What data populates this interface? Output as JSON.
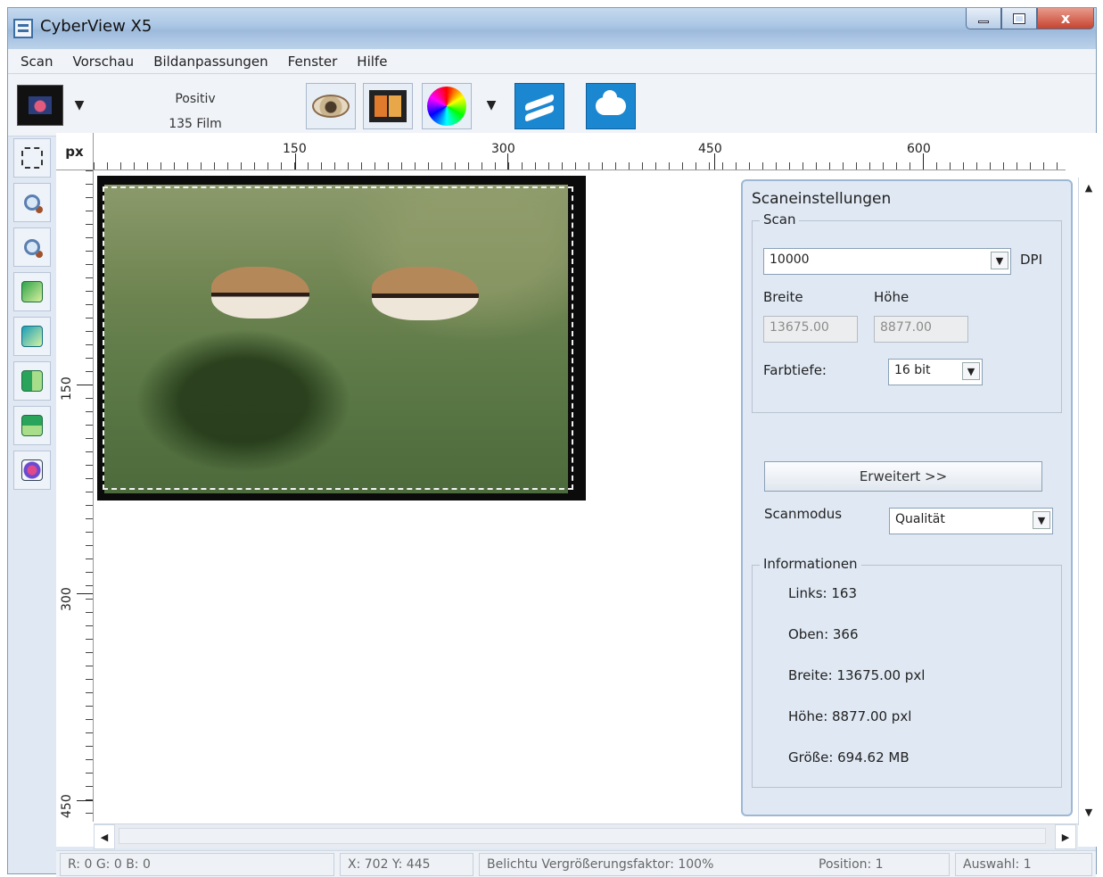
{
  "window": {
    "title": "CyberView X5",
    "controls": {
      "minimize": "",
      "maximize": "",
      "close": "x"
    }
  },
  "menu": [
    "Scan",
    "Vorschau",
    "Bildanpassungen",
    "Fenster",
    "Hilfe"
  ],
  "toolbar": {
    "mode_line1": "Positiv",
    "mode_line2": "135 Film",
    "dropdown_arrow": "▼",
    "icons": [
      "film-thumbnail-icon",
      "eye-icon",
      "filmstrip-icon",
      "color-wheel-icon",
      "hands-icon",
      "cloud-icon"
    ]
  },
  "left_tools": [
    "select-area-icon",
    "zoom-in-icon",
    "zoom-out-icon",
    "rotate-left-icon",
    "rotate-right-icon",
    "flip-horizontal-icon",
    "flip-vertical-icon",
    "color-adjust-icon"
  ],
  "ruler": {
    "unit": "px",
    "h_labels": [
      "150",
      "300",
      "450",
      "600"
    ],
    "v_labels": [
      "150",
      "300",
      "450"
    ]
  },
  "panel": {
    "title": "Scaneinstellungen",
    "scan_group": "Scan",
    "dpi_value": "10000",
    "dpi_unit": "DPI",
    "width_label": "Breite",
    "height_label": "Höhe",
    "width_value": "13675.00",
    "height_value": "8877.00",
    "color_depth_label": "Farbtiefe:",
    "color_depth_value": "16 bit",
    "advanced_button": "Erweitert >>",
    "scan_mode_label": "Scanmodus",
    "scan_mode_value": "Qualität",
    "info_group": "Informationen",
    "info": {
      "left": "Links: 163",
      "top": "Oben: 366",
      "width": "Breite: 13675.00 pxl",
      "height": "Höhe: 8877.00 pxl",
      "size": "Größe: 694.62 MB"
    }
  },
  "status": {
    "rgb": "R: 0 G: 0 B: 0",
    "xy": "X: 702 Y: 445",
    "exposure": "Belichtu Vergrößerungsfaktor: 100%",
    "position": "Position: 1",
    "selection": "Auswahl: 1"
  },
  "colors": {
    "window_bg": "#dfe8f3",
    "title_gradient_top": "#c6d9ee",
    "close_button": "#c6442f",
    "accent_blue": "#1c87d1"
  }
}
